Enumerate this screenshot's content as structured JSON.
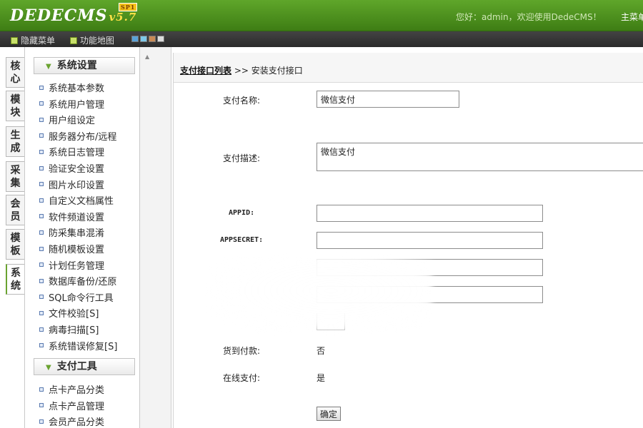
{
  "header": {
    "logo_text": "DEDECMS",
    "version": "v5.7",
    "edition_badge": "SP1",
    "welcome": "您好：admin，欢迎使用DedeCMS！",
    "top_menu": "主菜单"
  },
  "toolbar": {
    "hide_menu": "隐藏菜单",
    "function_map": "功能地图",
    "swatches": [
      "#5aa2d8",
      "#7ec8e8",
      "#c98a55",
      "#dcdcdc"
    ]
  },
  "vtabs": [
    "核心",
    "模块",
    "生成",
    "采集",
    "会员",
    "模板",
    "系统"
  ],
  "sidebar": {
    "section1": "系统设置",
    "items1": [
      "系统基本参数",
      "系统用户管理",
      "用户组设定",
      "服务器分布/远程",
      "系统日志管理",
      "验证安全设置",
      "图片水印设置",
      "自定义文档属性",
      "软件频道设置",
      "防采集串混淆",
      "随机模板设置",
      "计划任务管理",
      "数据库备份/还原",
      "SQL命令行工具",
      "文件校验[S]",
      "病毒扫描[S]",
      "系统错误修复[S]"
    ],
    "section2": "支付工具",
    "items2": [
      "点卡产品分类",
      "点卡产品管理",
      "会员产品分类"
    ]
  },
  "breadcrumb": {
    "link": "支付接口列表",
    "sep": ">>",
    "current": "安装支付接口"
  },
  "form": {
    "name_label": "支付名称:",
    "name_value": "微信支付",
    "desc_label": "支付描述:",
    "desc_value": "微信支付",
    "appid_label": "APPID:",
    "appsecret_label": "APPSECRET:",
    "cod_label": "货到付款:",
    "cod_value": "否",
    "online_label": "在线支付:",
    "online_value": "是",
    "submit": "确定"
  }
}
